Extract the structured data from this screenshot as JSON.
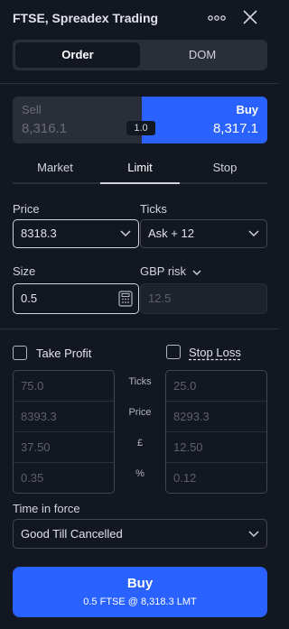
{
  "header": {
    "title": "FTSE, Spreadex Trading",
    "menu_glyph": "ooo",
    "close_icon": "close-icon"
  },
  "mode": {
    "order_label": "Order",
    "dom_label": "DOM",
    "selected": "Order"
  },
  "quote": {
    "sell_label": "Sell",
    "sell_price": "8,316.1",
    "buy_label": "Buy",
    "buy_price": "8,317.1",
    "spread": "1.0"
  },
  "order_types": {
    "tabs": [
      "Market",
      "Limit",
      "Stop"
    ],
    "selected": "Limit"
  },
  "price": {
    "label": "Price",
    "value": "8318.3"
  },
  "ticks": {
    "label": "Ticks",
    "value": "Ask + 12"
  },
  "size": {
    "label": "Size",
    "value": "0.5"
  },
  "risk": {
    "label": "GBP risk",
    "value": "12.5"
  },
  "take_profit": {
    "label": "Take Profit",
    "checked": false,
    "values": [
      "75.0",
      "8393.3",
      "37.50",
      "0.35"
    ]
  },
  "stop_loss": {
    "label": "Stop Loss",
    "checked": false,
    "values": [
      "25.0",
      "8293.3",
      "12.50",
      "0.12"
    ]
  },
  "row_labels": [
    "Ticks",
    "Price",
    "£",
    "%"
  ],
  "time_in_force": {
    "label": "Time in force",
    "value": "Good Till Cancelled"
  },
  "submit": {
    "label": "Buy",
    "summary": "0.5 FTSE @ 8,318.3 LMT"
  },
  "colors": {
    "buy_blue": "#2962ff",
    "background": "#131722",
    "panel": "#2a2e39"
  }
}
